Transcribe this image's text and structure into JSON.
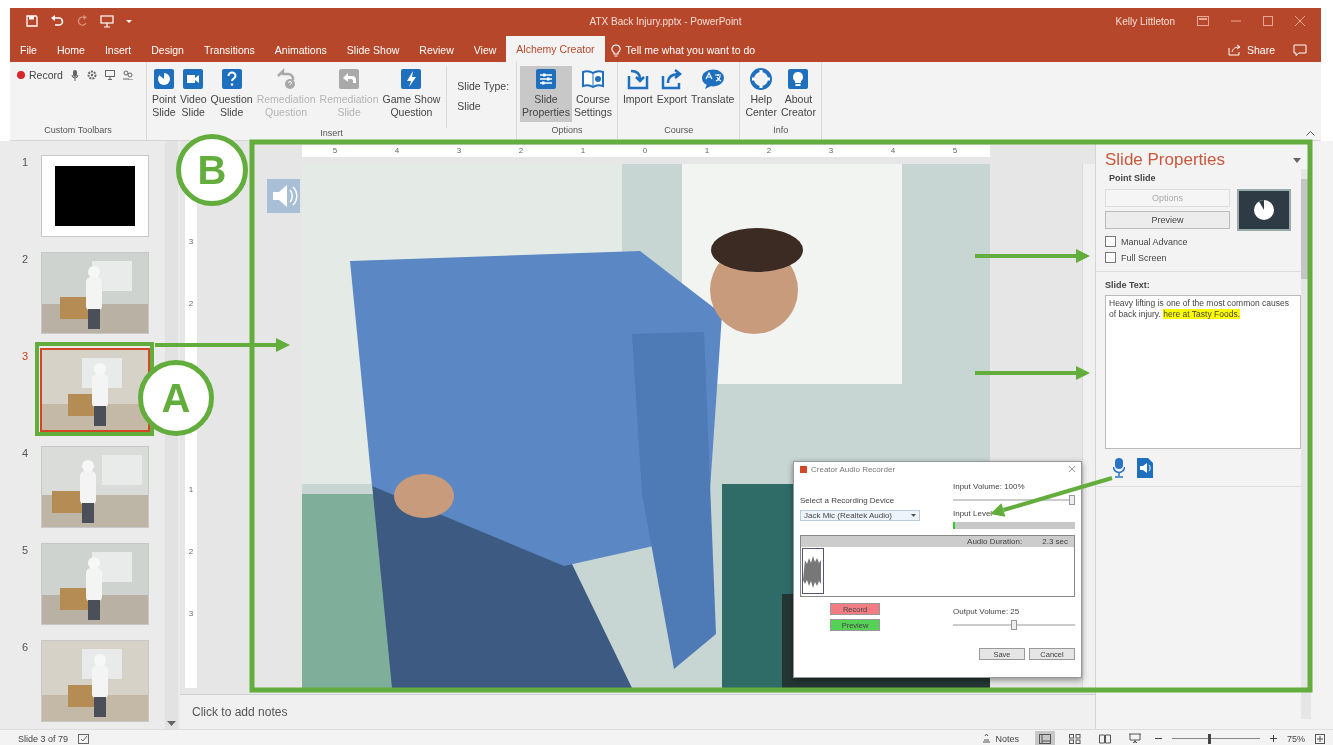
{
  "window": {
    "title": "ATX Back Injury.pptx  -  PowerPoint",
    "user": "Kelly Littleton"
  },
  "tabs": [
    {
      "label": "File",
      "selected": false
    },
    {
      "label": "Home",
      "selected": false
    },
    {
      "label": "Insert",
      "selected": false
    },
    {
      "label": "Design",
      "selected": false
    },
    {
      "label": "Transitions",
      "selected": false
    },
    {
      "label": "Animations",
      "selected": false
    },
    {
      "label": "Slide Show",
      "selected": false
    },
    {
      "label": "Review",
      "selected": false
    },
    {
      "label": "View",
      "selected": false
    },
    {
      "label": "Alchemy Creator",
      "selected": true
    }
  ],
  "tell_me": "Tell me what you want to do",
  "share": "Share",
  "ribbon": {
    "toolbar": {
      "record": "Record",
      "label": "Custom Toolbars"
    },
    "groups": [
      {
        "label": "Insert",
        "buttons": [
          {
            "label": "Point\nSlide",
            "kind": "point",
            "disabled": false,
            "selected": false
          },
          {
            "label": "Video\nSlide",
            "kind": "video",
            "disabled": false,
            "selected": false
          },
          {
            "label": "Question\nSlide",
            "kind": "question",
            "disabled": false,
            "selected": false
          },
          {
            "label": "Remediation\nQuestion",
            "kind": "remq",
            "disabled": true,
            "selected": false
          },
          {
            "label": "Remediation\nSlide",
            "kind": "rems",
            "disabled": true,
            "selected": false
          },
          {
            "label": "Game Show\nQuestion",
            "kind": "game",
            "disabled": false,
            "selected": false
          }
        ],
        "slide_type": {
          "label": "Slide Type:",
          "value": "Slide"
        }
      },
      {
        "label": "Options",
        "buttons": [
          {
            "label": "Slide\nProperties",
            "kind": "props",
            "disabled": false,
            "selected": true
          },
          {
            "label": "Course\nSettings",
            "kind": "settings",
            "disabled": false,
            "selected": false
          }
        ]
      },
      {
        "label": "Course",
        "buttons": [
          {
            "label": "Import",
            "kind": "import",
            "disabled": false,
            "selected": false
          },
          {
            "label": "Export",
            "kind": "export",
            "disabled": false,
            "selected": false
          },
          {
            "label": "Translate",
            "kind": "translate",
            "disabled": false,
            "selected": false
          }
        ]
      },
      {
        "label": "Info",
        "buttons": [
          {
            "label": "Help\nCenter",
            "kind": "help",
            "disabled": false,
            "selected": false
          },
          {
            "label": "About\nCreator",
            "kind": "about",
            "disabled": false,
            "selected": false
          }
        ]
      }
    ]
  },
  "slides": [
    {
      "number": "1",
      "kind": "blank",
      "selected": false
    },
    {
      "number": "2",
      "kind": "picture",
      "selected": false
    },
    {
      "number": "3",
      "kind": "picture",
      "selected": true
    },
    {
      "number": "4",
      "kind": "picture",
      "selected": false
    },
    {
      "number": "5",
      "kind": "picture",
      "selected": false
    },
    {
      "number": "6",
      "kind": "picture",
      "selected": false
    }
  ],
  "ruler": {
    "horizontal": [
      "5",
      "4",
      "3",
      "2",
      "1",
      "0",
      "1",
      "2",
      "3",
      "4",
      "5"
    ],
    "vertical": [
      "3",
      "2",
      "1",
      "2",
      "3"
    ]
  },
  "notes": {
    "hint": "Click to add notes"
  },
  "dialog": {
    "title": "Creator Audio Recorder",
    "device_label": "Select a Recording Device",
    "device": "Jack Mic (Realtek Audio)",
    "input_volume": {
      "label": "Input Volume: 100%",
      "level": 1.0
    },
    "input_level": {
      "label": "Input Level",
      "level": 0.02
    },
    "duration_label": "Audio Duration:",
    "duration": "2.3 sec",
    "record": "Record",
    "preview": "Preview",
    "output_volume": {
      "label": "Output Volume: 25",
      "level": 0.5
    },
    "save": "Save",
    "cancel": "Cancel"
  },
  "pane": {
    "title": "Slide Properties",
    "section": "Point Slide",
    "buttons": [
      {
        "label": "Options",
        "disabled": true
      },
      {
        "label": "Preview",
        "disabled": false
      }
    ],
    "checkboxes": [
      {
        "label": "Manual Advance",
        "checked": false
      },
      {
        "label": "Full Screen",
        "checked": false
      }
    ],
    "text_label": "Slide Text:",
    "slide_text": {
      "text": "Heavy lifting is one of the most common causes of back injury. ",
      "highlight": "here at Tasty Foods."
    }
  },
  "status": {
    "slide": "Slide 3 of 79",
    "notes": "Notes",
    "zoom": "75%",
    "zoom_slider": {
      "level": 0.42
    }
  },
  "annotations": [
    {
      "label": "A"
    },
    {
      "label": "B"
    }
  ]
}
